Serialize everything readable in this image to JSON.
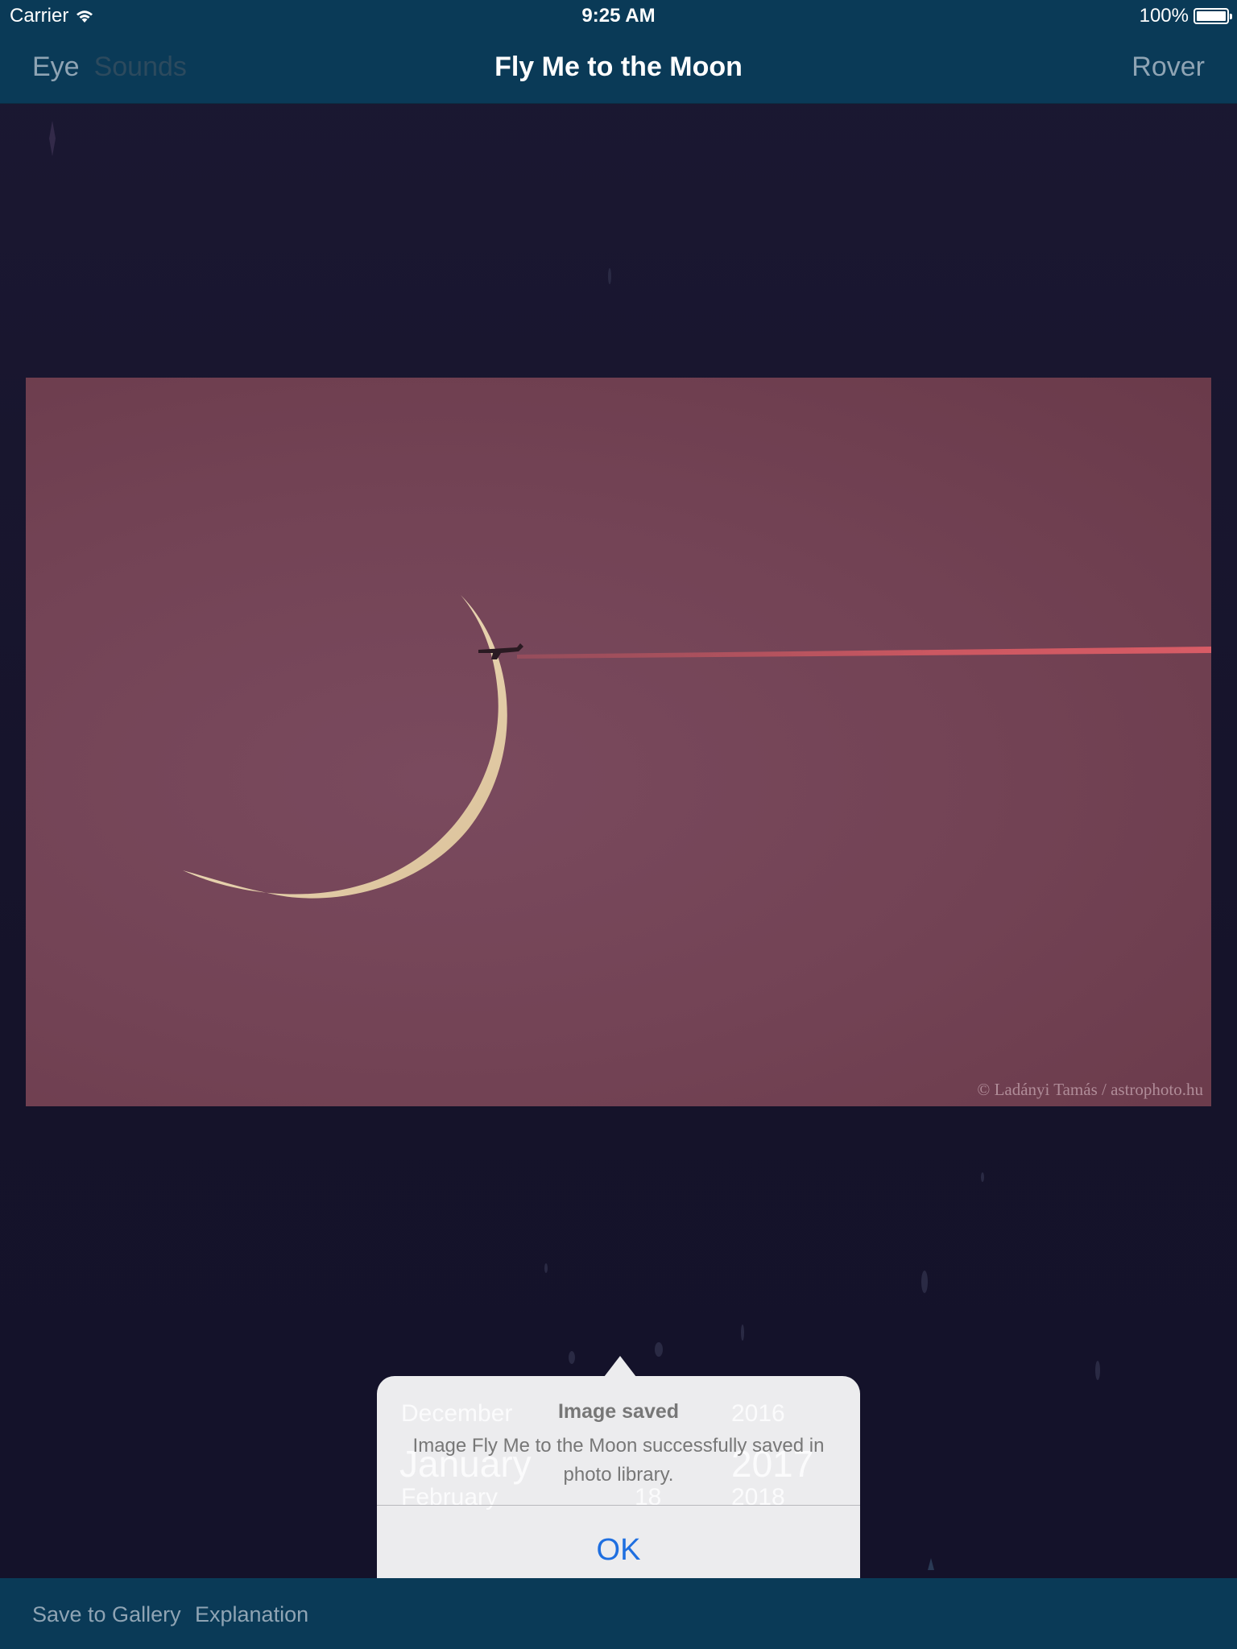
{
  "status_bar": {
    "carrier": "Carrier",
    "time": "9:25 AM",
    "battery": "100%"
  },
  "nav_bar": {
    "left_items": [
      "Eye",
      "Sounds"
    ],
    "title": "Fly Me to the Moon",
    "right_item": "Rover"
  },
  "photo": {
    "credit": "© Ladányi Tamás / astrophoto.hu"
  },
  "alert": {
    "title": "Image saved",
    "message": "Image Fly Me to the Moon successfully saved in photo library.",
    "ok_label": "OK",
    "background_picker": {
      "month_prev": "December",
      "month_current": "January",
      "month_next": "February",
      "day_next": "18",
      "year_prev": "2016",
      "year_current": "2017",
      "year_next": "2018"
    }
  },
  "toolbar": {
    "save_label": "Save to Gallery",
    "explanation_label": "Explanation"
  },
  "colors": {
    "bar_background": "#0a3a57",
    "page_background": "#16142a",
    "accent_blue": "#1f6fe0",
    "photo_sky": "#734355"
  }
}
